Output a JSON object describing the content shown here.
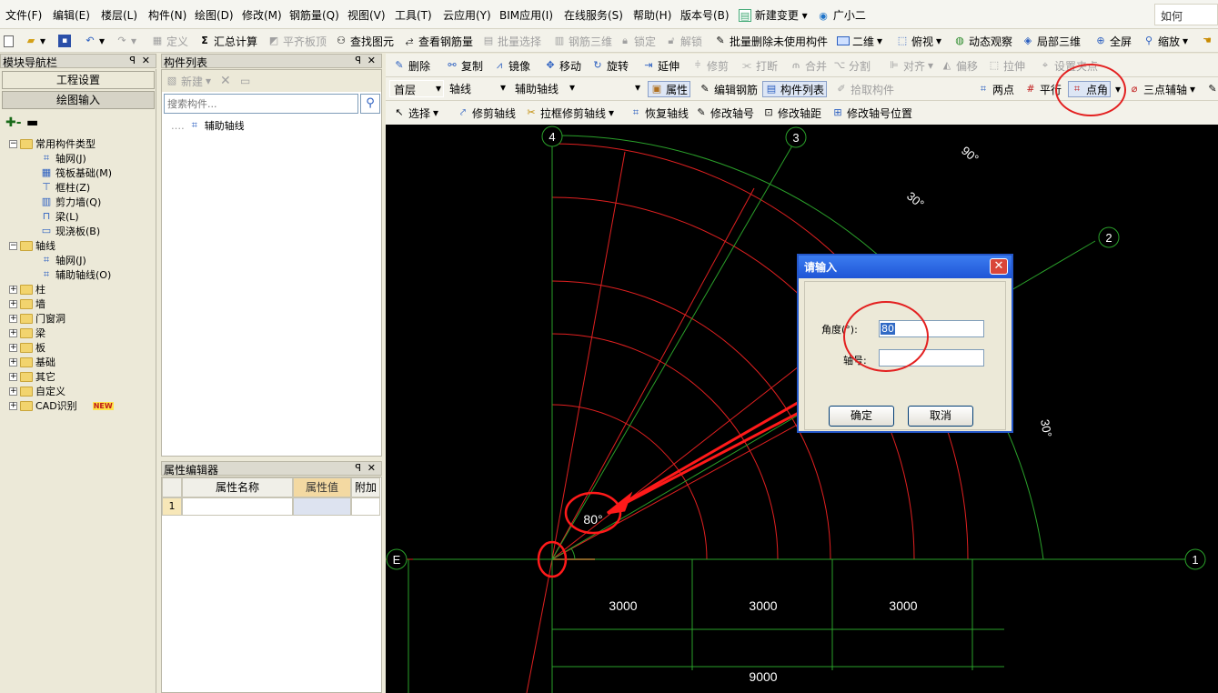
{
  "menu": [
    "文件(F)",
    "编辑(E)",
    "楼层(L)",
    "构件(N)",
    "绘图(D)",
    "修改(M)",
    "钢筋量(Q)",
    "视图(V)",
    "工具(T)",
    "云应用(Y)",
    "BIM应用(I)",
    "在线服务(S)",
    "帮助(H)",
    "版本号(B)",
    "新建变更",
    "广小二"
  ],
  "help_search": "如何",
  "toolbar1": {
    "define": "定义",
    "sum_calc": "汇总计算",
    "flat_slab_top": "平齐板顶",
    "find_elem": "查找图元",
    "view_rebar": "查看钢筋量",
    "batch_select": "批量选择",
    "rebar_3d": "钢筋三维",
    "lock": "锁定",
    "unlock": "解锁",
    "batch_delete": "批量删除未使用构件",
    "two_d": "二维",
    "top_view": "俯视",
    "dyn_view": "动态观察",
    "local_3d": "局部三维",
    "fullscreen": "全屏",
    "zoom": "缩放"
  },
  "toolbar2": [
    "删除",
    "复制",
    "镜像",
    "移动",
    "旋转",
    "延伸",
    "修剪",
    "打断",
    "合并",
    "分割",
    "对齐",
    "偏移",
    "拉伸",
    "设置夹点"
  ],
  "toolbar3": {
    "floor": "首层",
    "type": "轴线",
    "sub_type": "辅助轴线",
    "blank": "",
    "property": "属性",
    "edit_rebar": "编辑钢筋",
    "comp_list": "构件列表",
    "pick_comp": "拾取构件",
    "two_points": "两点",
    "parallel": "平行",
    "point_angle": "点角",
    "three_point_aux": "三点辅轴"
  },
  "toolbar4": [
    "选择",
    "修剪轴线",
    "拉框修剪轴线",
    "恢复轴线",
    "修改轴号",
    "修改轴距",
    "修改轴号位置"
  ],
  "nav": {
    "title": "模块导航栏",
    "project_settings": "工程设置",
    "drawing_input": "绘图输入",
    "tree": [
      {
        "label": "常用构件类型",
        "level": 0,
        "open": true
      },
      {
        "label": "轴网(J)",
        "level": 1
      },
      {
        "label": "筏板基础(M)",
        "level": 1
      },
      {
        "label": "框柱(Z)",
        "level": 1
      },
      {
        "label": "剪力墙(Q)",
        "level": 1
      },
      {
        "label": "梁(L)",
        "level": 1
      },
      {
        "label": "现浇板(B)",
        "level": 1
      },
      {
        "label": "轴线",
        "level": 0,
        "open": true
      },
      {
        "label": "轴网(J)",
        "level": 1
      },
      {
        "label": "辅助轴线(O)",
        "level": 1
      },
      {
        "label": "柱",
        "level": 0
      },
      {
        "label": "墙",
        "level": 0
      },
      {
        "label": "门窗洞",
        "level": 0
      },
      {
        "label": "梁",
        "level": 0
      },
      {
        "label": "板",
        "level": 0
      },
      {
        "label": "基础",
        "level": 0
      },
      {
        "label": "其它",
        "level": 0
      },
      {
        "label": "自定义",
        "level": 0
      },
      {
        "label": "CAD识别",
        "level": 0
      }
    ],
    "new_badge": "NEW"
  },
  "comp_list": {
    "title": "构件列表",
    "new_btn": "新建",
    "search_placeholder": "搜索构件...",
    "item": "辅助轴线"
  },
  "prop_editor": {
    "title": "属性编辑器",
    "col_name": "属性名称",
    "col_value": "属性值",
    "col_extra": "附加",
    "row1": "1"
  },
  "canvas": {
    "axis_labels": [
      "4",
      "3",
      "2",
      "1",
      "E"
    ],
    "angle_labels": [
      "90°",
      "30°",
      "30°",
      "30°"
    ],
    "dims": [
      "3000",
      "3000",
      "3000",
      "9000"
    ],
    "angle_mark": "80°"
  },
  "dialog": {
    "title": "请输入",
    "angle_label": "角度(°):",
    "angle_value": "80",
    "axis_label": "轴号:",
    "axis_value": "",
    "ok": "确定",
    "cancel": "取消"
  }
}
